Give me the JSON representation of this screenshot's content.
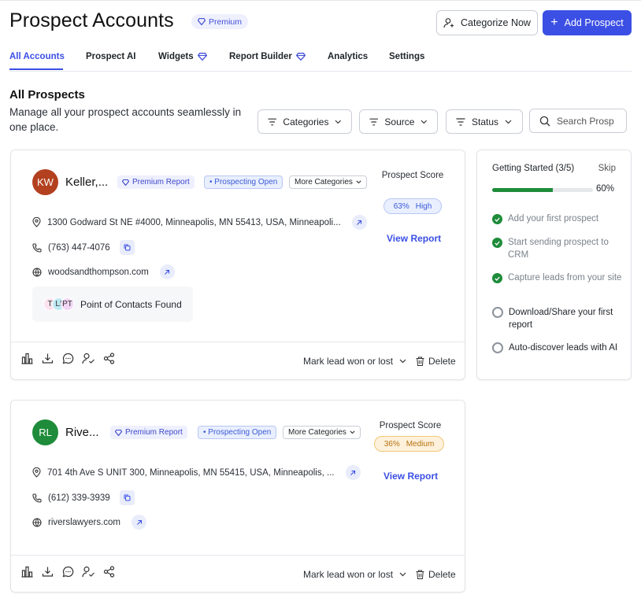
{
  "header": {
    "title": "Prospect Accounts",
    "premium_badge": "Premium",
    "categorize_button": "Categorize Now",
    "add_button": "Add Prospect"
  },
  "tabs": [
    {
      "label": "All Accounts",
      "active": true
    },
    {
      "label": "Prospect AI"
    },
    {
      "label": "Widgets",
      "premium": true
    },
    {
      "label": "Report Builder",
      "premium": true
    },
    {
      "label": "Analytics"
    },
    {
      "label": "Settings"
    }
  ],
  "section": {
    "title": "All Prospects",
    "description": "Manage all your prospect accounts seamlessly in one place."
  },
  "filters": {
    "categories": "Categories",
    "source": "Source",
    "status": "Status",
    "search_placeholder": "Search Prosp"
  },
  "prospects": [
    {
      "initials": "KW",
      "avatar_color": "#b3401f",
      "name": "Keller,...",
      "premium_label": "Premium Report",
      "status_label": "• Prospecting Open",
      "more_label": "More Categories",
      "address": "1300 Godward St NE #4000, Minneapolis, MN 55413, USA, Minneapoli...",
      "phone": "(763) 447-4076",
      "website": "woodsandthompson.com",
      "poc_avatars": [
        "T",
        "LI",
        "PT"
      ],
      "poc_label": "Point of Contacts Found",
      "score_label": "Prospect Score",
      "score_value": "63%",
      "score_level": "High",
      "view_report": "View Report",
      "mark_lead": "Mark lead won or lost",
      "delete": "Delete"
    },
    {
      "initials": "RL",
      "avatar_color": "#1e8c3a",
      "name": "Rive...",
      "premium_label": "Premium Report",
      "status_label": "• Prospecting Open",
      "more_label": "More Categories",
      "address": "701 4th Ave S UNIT 300, Minneapolis, MN 55415, USA, Minneapolis, ...",
      "phone": "(612) 339-3939",
      "website": "riverslawyers.com",
      "score_label": "Prospect Score",
      "score_value": "36%",
      "score_level": "Medium",
      "view_report": "View Report",
      "mark_lead": "Mark lead won or lost",
      "delete": "Delete"
    }
  ],
  "getting_started": {
    "title": "Getting Started (3/5)",
    "skip": "Skip",
    "percent": "60%",
    "progress": 0.6,
    "items": [
      {
        "label": "Add your first prospect",
        "done": true
      },
      {
        "label": "Start sending prospect to CRM",
        "done": true
      },
      {
        "label": "Capture leads from your site",
        "done": true
      },
      {
        "label": "Download/Share your first report",
        "done": false
      },
      {
        "label": "Auto-discover leads with AI",
        "done": false
      }
    ]
  },
  "colors": {
    "accent": "#3b4fe4",
    "success": "#1e8c3a"
  }
}
